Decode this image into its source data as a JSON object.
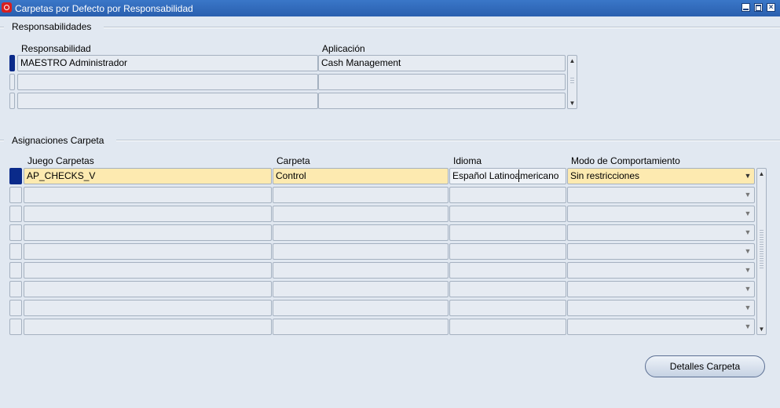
{
  "window": {
    "title": "Carpetas por Defecto por Responsabilidad"
  },
  "responsabilidades": {
    "section_label": "Responsabilidades",
    "columns": [
      "Responsabilidad",
      "Aplicación"
    ],
    "rows": [
      [
        "MAESTRO Administrador",
        "Cash Management"
      ],
      [
        "",
        ""
      ],
      [
        "",
        ""
      ]
    ]
  },
  "asignaciones": {
    "section_label": "Asignaciones Carpeta",
    "columns": [
      "Juego Carpetas",
      "Carpeta",
      "Idioma",
      "Modo de Comportamiento"
    ],
    "rows": [
      [
        "AP_CHECKS_V",
        "Control",
        "Español Latinoamericano",
        "Sin restricciones"
      ],
      [
        "",
        "",
        "",
        ""
      ],
      [
        "",
        "",
        "",
        ""
      ],
      [
        "",
        "",
        "",
        ""
      ],
      [
        "",
        "",
        "",
        ""
      ],
      [
        "",
        "",
        "",
        ""
      ],
      [
        "",
        "",
        "",
        ""
      ],
      [
        "",
        "",
        "",
        ""
      ],
      [
        "",
        "",
        "",
        ""
      ]
    ]
  },
  "buttons": {
    "detalles_carpeta": "Detalles Carpeta"
  },
  "icons": {
    "app": "oracle-logo-icon",
    "minimize": "minimize-icon",
    "maximize": "maximize-icon",
    "close": "close-icon",
    "dropdown": "chevron-down-icon",
    "scroll_up": "arrow-up-icon",
    "scroll_down": "arrow-down-icon"
  },
  "colors": {
    "titlebar": "#2a5fae",
    "background": "#e1e8f1",
    "active_field": "#fdeab0",
    "record_indicator": "#0a2a8a"
  }
}
